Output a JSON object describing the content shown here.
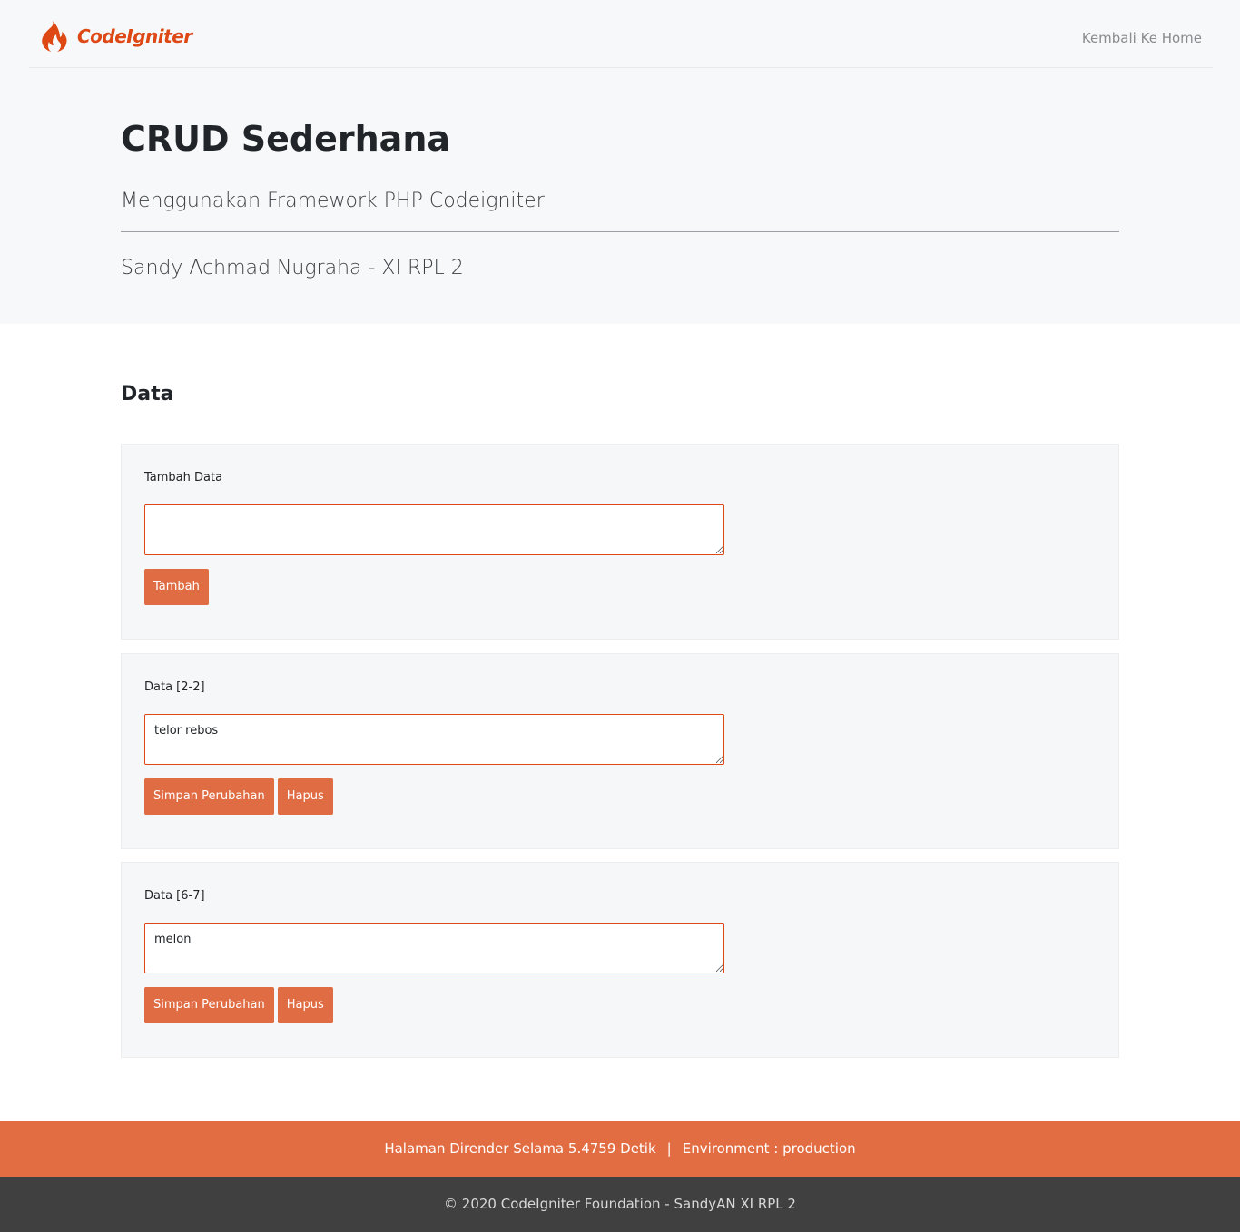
{
  "nav": {
    "logo_text": "CodeIgniter",
    "home_link": "Kembali Ke Home"
  },
  "hero": {
    "title": "CRUD Sederhana",
    "subtitle": "Menggunakan Framework PHP Codeigniter",
    "author": "Sandy Achmad Nugraha - XI RPL 2"
  },
  "section": {
    "title": "Data"
  },
  "add_form": {
    "label": "Tambah Data",
    "value": "",
    "submit_label": "Tambah"
  },
  "records": [
    {
      "label": "Data [2-2]",
      "value": "telor rebos",
      "save_label": "Simpan Perubahan",
      "delete_label": "Hapus"
    },
    {
      "label": "Data [6-7]",
      "value": "melon",
      "save_label": "Simpan Perubahan",
      "delete_label": "Hapus"
    }
  ],
  "footer": {
    "render_time": "Halaman Dirender Selama 5.4759 Detik",
    "separator": "|",
    "environment": "Environment : production",
    "copyright": "© 2020 CodeIgniter Foundation - SandyAN XI RPL 2"
  },
  "colors": {
    "brand": "#dd4814",
    "button": "#e06c43",
    "footer_orange": "#e36d43",
    "footer_dark": "#404040",
    "hero_bg": "#f7f8f9"
  },
  "icons": {
    "logo": "flame-icon"
  }
}
